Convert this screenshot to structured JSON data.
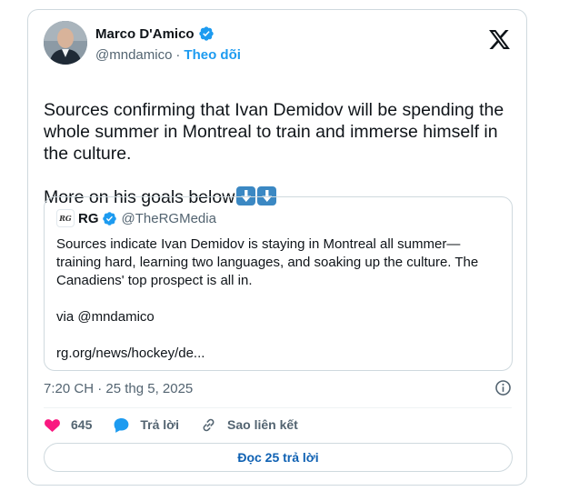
{
  "author": {
    "name": "Marco D'Amico",
    "handle": "@mndamico",
    "separator": "·",
    "follow_label": "Theo dõi"
  },
  "tweet": {
    "text": "Sources confirming that Ivan Demidov will be spending the whole summer in Montreal to train and immerse himself in the culture.",
    "text2": "More on his goals below"
  },
  "quote": {
    "avatar_text": "RG",
    "name": "RG",
    "handle": "@TheRGMedia",
    "text": "Sources indicate Ivan Demidov is staying in Montreal all summer—training hard, learning two languages, and soaking up the culture. The Canadiens' top prospect is all in.\n\nvia @mndamico\n\nrg.org/news/hockey/de..."
  },
  "meta": {
    "timestamp": "7:20 CH · 25 thg 5, 2025"
  },
  "actions": {
    "likes": "645",
    "reply_label": "Trả lời",
    "copy_link_label": "Sao liên kết"
  },
  "read_replies_label": "Đọc 25 trả lời",
  "colors": {
    "accent": "#1d9bf0",
    "like": "#f91880",
    "reply_button_text": "#0f61b3",
    "muted": "#536471"
  },
  "icons": [
    "verified-badge-icon",
    "x-logo-icon",
    "arrow-down-emoji-icon",
    "info-icon",
    "heart-icon",
    "reply-bubble-icon",
    "link-icon"
  ]
}
